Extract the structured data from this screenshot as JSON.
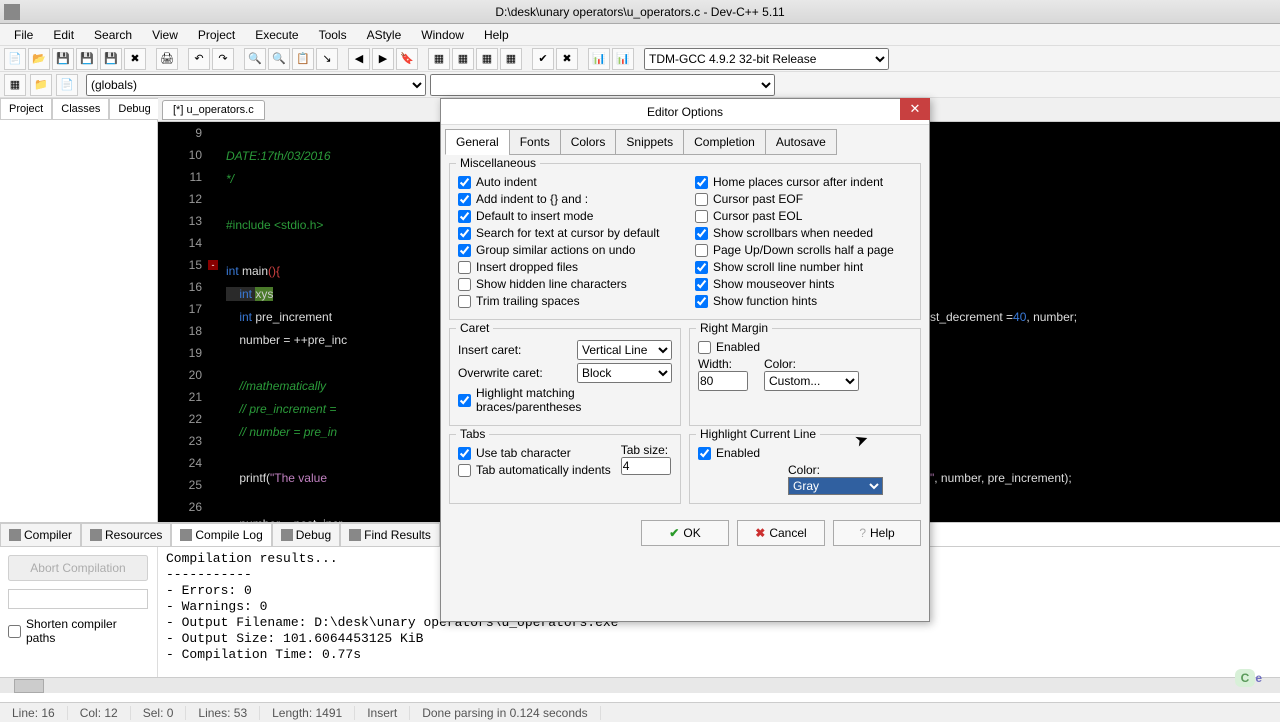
{
  "titlebar": "D:\\desk\\unary operators\\u_operators.c - Dev-C++ 5.11",
  "menu": [
    "File",
    "Edit",
    "Search",
    "View",
    "Project",
    "Execute",
    "Tools",
    "AStyle",
    "Window",
    "Help"
  ],
  "compiler_select": "TDM-GCC 4.9.2 32-bit Release",
  "globals_select": "(globals)",
  "left_tabs": [
    "Project",
    "Classes",
    "Debug"
  ],
  "editor_tab": "[*] u_operators.c",
  "line_nums": [
    "9",
    "10",
    "11",
    "12",
    "13",
    "14",
    "15",
    "16",
    "17",
    "18",
    "19",
    "20",
    "21",
    "22",
    "23",
    "24",
    "25",
    "26"
  ],
  "code": {
    "l10": "DATE:17th/03/2016",
    "l11": "*/",
    "l13": "#include <stdio.h>",
    "l15_kw": "int ",
    "l15_fn": "main",
    "l15_par": "(){",
    "l16_kw": "int ",
    "l16_cur": "xys",
    "l17_kw": "int ",
    "l17_rest": "pre_increment",
    "l17_right": "st_decrement =",
    "l17_num": "40",
    "l17_tail": ", number;",
    "l18": "number = ++pre_inc",
    "l20": "//mathematically",
    "l21": "// pre_increment =",
    "l22": "// number = pre_in",
    "l24a": "printf(",
    "l24b": "\"The value ",
    "l24_right_a": "\"",
    "l24_right_b": ", number, pre_increment);",
    "l26": "number = post_incr"
  },
  "bottom_tabs": [
    "Compiler",
    "Resources",
    "Compile Log",
    "Debug",
    "Find Results"
  ],
  "abort_btn": "Abort Compilation",
  "shorten_chk": "Shorten compiler paths",
  "compile_output": "Compilation results...\n-----------\n- Errors: 0\n- Warnings: 0\n- Output Filename: D:\\desk\\unary operators\\u_operators.exe\n- Output Size: 101.6064453125 KiB\n- Compilation Time: 0.77s",
  "status": {
    "line": "Line:   16",
    "col": "Col:   12",
    "sel": "Sel:   0",
    "lines": "Lines:   53",
    "length": "Length:   1491",
    "insert": "Insert",
    "done": "Done parsing in 0.124 seconds"
  },
  "dialog": {
    "title": "Editor Options",
    "tabs": [
      "General",
      "Fonts",
      "Colors",
      "Snippets",
      "Completion",
      "Autosave"
    ],
    "misc_title": "Miscellaneous",
    "misc_left": [
      {
        "l": "Auto indent",
        "c": true
      },
      {
        "l": "Add indent to {} and :",
        "c": true
      },
      {
        "l": "Default to insert mode",
        "c": true
      },
      {
        "l": "Search for text at cursor by default",
        "c": true
      },
      {
        "l": "Group similar actions on undo",
        "c": true
      },
      {
        "l": "Insert dropped files",
        "c": false
      },
      {
        "l": "Show hidden line characters",
        "c": false
      },
      {
        "l": "Trim trailing spaces",
        "c": false
      }
    ],
    "misc_right": [
      {
        "l": "Home places cursor after indent",
        "c": true
      },
      {
        "l": "Cursor past EOF",
        "c": false
      },
      {
        "l": "Cursor past EOL",
        "c": false
      },
      {
        "l": "Show scrollbars when needed",
        "c": true
      },
      {
        "l": "Page Up/Down scrolls half a page",
        "c": false
      },
      {
        "l": "Show scroll line number hint",
        "c": true
      },
      {
        "l": "Show mouseover hints",
        "c": true
      },
      {
        "l": "Show function hints",
        "c": true
      }
    ],
    "caret": {
      "title": "Caret",
      "insert_l": "Insert caret:",
      "insert_v": "Vertical Line",
      "over_l": "Overwrite caret:",
      "over_v": "Block",
      "hilite": "Highlight matching braces/parentheses",
      "hilite_c": true
    },
    "margin": {
      "title": "Right Margin",
      "enabled_l": "Enabled",
      "enabled_c": false,
      "width_l": "Width:",
      "width_v": "80",
      "color_l": "Color:",
      "color_v": "Custom..."
    },
    "tabs_g": {
      "title": "Tabs",
      "use_l": "Use tab character",
      "use_c": true,
      "auto_l": "Tab automatically indents",
      "auto_c": false,
      "size_l": "Tab size:",
      "size_v": "4"
    },
    "hilite_g": {
      "title": "Highlight Current Line",
      "enabled_l": "Enabled",
      "enabled_c": true,
      "color_l": "Color:",
      "color_v": "Gray"
    },
    "ok": "OK",
    "cancel": "Cancel",
    "help": "Help"
  }
}
